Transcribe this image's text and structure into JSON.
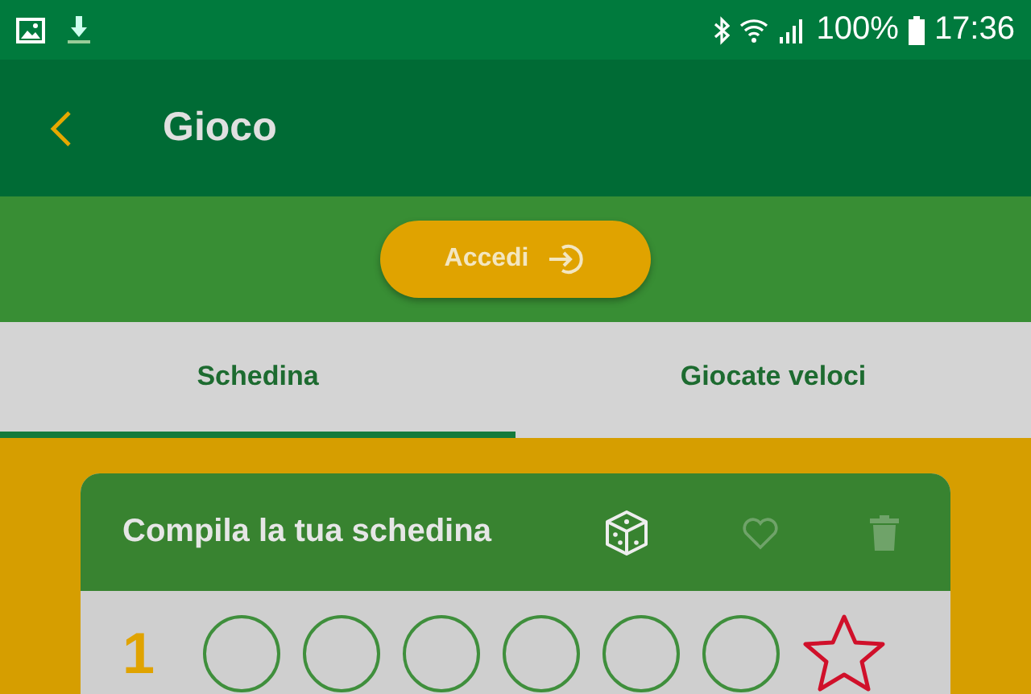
{
  "status_bar": {
    "battery": "100%",
    "time": "17:36"
  },
  "app_bar": {
    "title": "Gioco"
  },
  "login_button": {
    "label": "Accedi"
  },
  "tabs": [
    {
      "label": "Schedina",
      "selected": true
    },
    {
      "label": "Giocate veloci",
      "selected": false
    }
  ],
  "card": {
    "title": "Compila la tua schedina",
    "actions": [
      {
        "kind": "dice",
        "disabled": false
      },
      {
        "kind": "heart",
        "disabled": true
      },
      {
        "kind": "trash",
        "disabled": true
      }
    ],
    "rows": [
      {
        "number": "1",
        "circles": [
          {
            "checked": false
          },
          {
            "checked": false
          },
          {
            "checked": false
          },
          {
            "checked": false
          },
          {
            "checked": false
          },
          {
            "checked": false
          }
        ],
        "star_checked": false
      }
    ]
  }
}
